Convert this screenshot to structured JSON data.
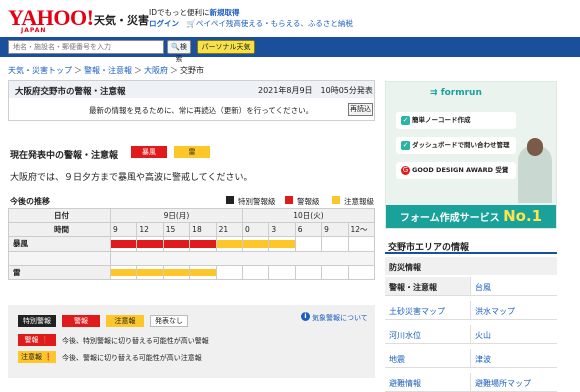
{
  "header": {
    "logo": "YAHOO!",
    "logo_sub": "JAPAN",
    "app_title": "天気・災害",
    "id_promo_prefix": "IDでもっと便利に",
    "id_promo_link": "新規取得",
    "login": "ログイン",
    "paypay_promo": "ペイペイ残高使える・もらえる、ふるさと納税"
  },
  "search": {
    "placeholder": "地名・施設名・郵便番号を入力",
    "button": "検索",
    "personal_button": "パーソナル天気"
  },
  "breadcrumb": [
    "天気・災害トップ",
    "警報・注意報",
    "大阪府",
    "交野市"
  ],
  "warning": {
    "title": "大阪府交野市の警報・注意報",
    "issued": "2021年8月9日　10時05分発表",
    "refresh_note": "最新の情報を見るために、常に再読込（更新）を行ってください。",
    "refresh_button": "再読込",
    "current_label": "現在発表中の警報・注意報",
    "badges": [
      "暴風",
      "雷"
    ],
    "description": "大阪府では、９日夕方まで暴風や高波に警戒してください。"
  },
  "trend": {
    "label": "今後の推移",
    "legend": [
      "特別警報級",
      "警報級",
      "注意報級"
    ],
    "date_header": "日付",
    "time_header": "時間",
    "dates": [
      "9日(月)",
      "10日(火)"
    ],
    "times": [
      "9",
      "12",
      "15",
      "18",
      "21",
      "0",
      "3",
      "6",
      "9",
      "12〜"
    ],
    "rows": [
      {
        "label": "暴風",
        "levels": [
          "警報級",
          "警報級",
          "警報級",
          "警報級",
          "注意報級",
          "注意報級",
          "注意報級",
          "",
          "",
          ""
        ]
      },
      {
        "label": "雷",
        "levels": [
          "注意報級",
          "注意報級",
          "注意報級",
          "注意報級",
          "",
          "",
          "",
          "",
          "",
          ""
        ]
      }
    ]
  },
  "legend_box": {
    "pills": [
      "特別警報",
      "警報",
      "注意報",
      "発表なし"
    ],
    "jma_link": "気象警報について",
    "expl": [
      {
        "tag": "警報",
        "text": "今後、特別警報に切り替える可能性が高い警報"
      },
      {
        "tag": "注意報",
        "text": "今後、警報に切り替える可能性が高い注意報"
      }
    ]
  },
  "ad": {
    "brand": "formrun",
    "rows": [
      "簡単ノーコード作成",
      "ダッシュボードで問い合わせ管理",
      "GOOD DESIGN AWARD 受賞"
    ],
    "banner": "フォーム作成サービス",
    "banner_no1": "No.1"
  },
  "area": {
    "title": "交野市エリアの情報",
    "section": "防災情報",
    "links": [
      "警報・注意報",
      "台風",
      "土砂災害マップ",
      "洪水マップ",
      "河川水位",
      "火山",
      "地震",
      "津波",
      "避難情報",
      "避難場所マップ"
    ]
  },
  "colors": {
    "special": "#222222",
    "warning": "#e01b1b",
    "advisory": "#fdc72a",
    "brand_red": "#e60012",
    "nav_blue": "#1a4f9c"
  }
}
